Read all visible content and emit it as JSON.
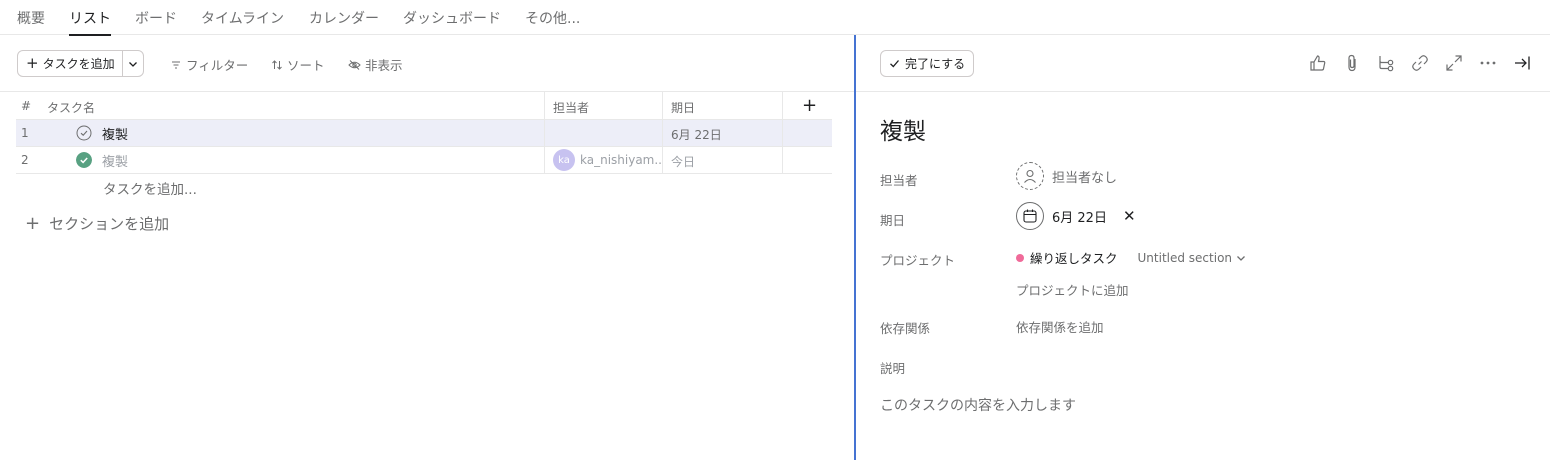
{
  "tabs": [
    "概要",
    "リスト",
    "ボード",
    "タイムライン",
    "カレンダー",
    "ダッシュボード",
    "その他..."
  ],
  "toolbar": {
    "add_task": "タスクを追加",
    "filter": "フィルター",
    "sort": "ソート",
    "hide": "非表示"
  },
  "table": {
    "headers": {
      "num": "#",
      "name": "タスク名",
      "assignee": "担当者",
      "due": "期日"
    },
    "rows": [
      {
        "num": "1",
        "name": "複製",
        "assignee": "",
        "avatar": "",
        "due": "6月 22日",
        "completed": false,
        "selected": true
      },
      {
        "num": "2",
        "name": "複製",
        "assignee": "ka_nishiyam...",
        "avatar": "ka",
        "due": "今日",
        "completed": true,
        "selected": false
      }
    ],
    "add_row": "タスクを追加...",
    "add_section": "セクションを追加"
  },
  "detail": {
    "complete_button": "完了にする",
    "title": "複製",
    "assignee_label": "担当者",
    "assignee_value": "担当者なし",
    "due_label": "期日",
    "due_value": "6月 22日",
    "project_label": "プロジェクト",
    "project_name": "繰り返しタスク",
    "project_section": "Untitled section",
    "add_project": "プロジェクトに追加",
    "dependency_label": "依存関係",
    "dependency_add": "依存関係を追加",
    "description_label": "説明",
    "description_placeholder": "このタスクの内容を入力します"
  },
  "colors": {
    "accent": "#4573d2",
    "complete_green": "#58a182",
    "project_dot": "#f06a99",
    "selected_row": "#edeef8"
  }
}
